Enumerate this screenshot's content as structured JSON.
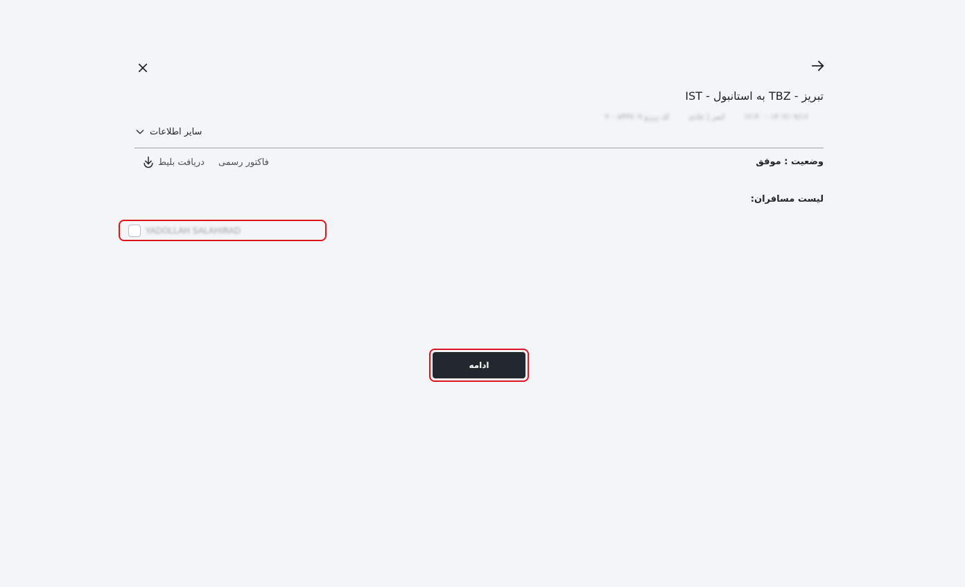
{
  "header": {
    "back_icon": "arrow-right-icon",
    "close_icon": "close-icon",
    "route_title": "تبریز - TBZ به استانبول - IST",
    "meta": {
      "date_time": "۱۴۰۲/۰۹/۱۶ - ۱۲:۳۰",
      "flight_info": "اتمر | عادی",
      "order_code": "کد رزرو ۲۰۰۸۴۴۷۰۹"
    }
  },
  "more_info": {
    "label": "سایر اطلاعات",
    "icon": "chevron-down-icon"
  },
  "status": {
    "text": "وضعیت : موفق"
  },
  "actions": {
    "official_invoice": "فاکتور رسمی",
    "download_ticket": "دریافت بلیط",
    "download_icon": "download-icon"
  },
  "passengers": {
    "heading": "لیست مسافران:",
    "items": [
      {
        "name": "YADOLLAH SALAHIRAD",
        "checked": false
      }
    ]
  },
  "continue_button": {
    "label": "ادامه"
  },
  "colors": {
    "background": "#f4f5f7",
    "primary_button": "#23282e",
    "highlight_border": "#e0131c",
    "divider": "#9fa3a8"
  }
}
